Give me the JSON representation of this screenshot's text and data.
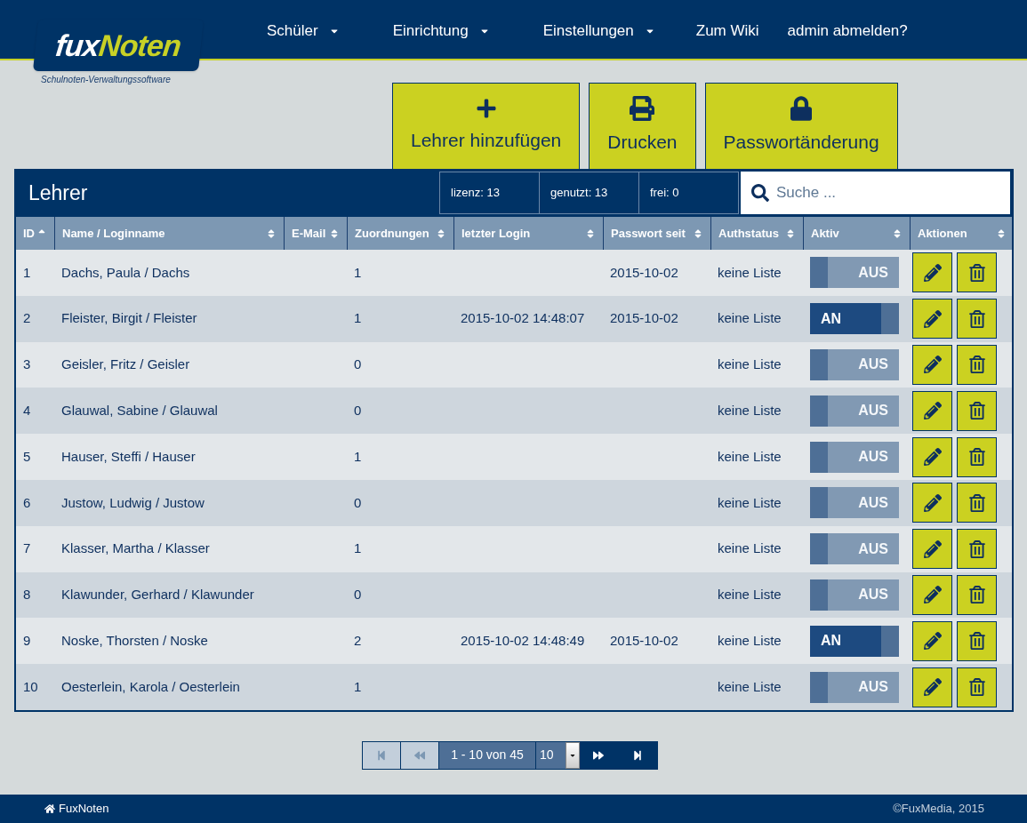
{
  "brand": {
    "name_part1": "fux",
    "name_part2": "Noten",
    "tagline": "Schulnoten-Verwaltungssoftware"
  },
  "nav": [
    {
      "label": "Schüler",
      "kind": "dropdown"
    },
    {
      "label": "Einrichtung",
      "kind": "dropdown"
    },
    {
      "label": "Einstellungen",
      "kind": "dropdown"
    },
    {
      "label": "Zum Wiki",
      "kind": "link"
    },
    {
      "label": "admin abmelden?",
      "kind": "link"
    }
  ],
  "actions": [
    {
      "label": "Lehrer hinzufügen",
      "kind": "add"
    },
    {
      "label": "Drucken",
      "kind": "print"
    },
    {
      "label": "Passwortänderung",
      "kind": "lock"
    }
  ],
  "panel": {
    "title": "Lehrer",
    "stats": [
      "lizenz: 13",
      "genutzt: 13",
      "frei: 0"
    ],
    "search": {
      "placeholder": "Suche ..."
    }
  },
  "table": {
    "columns": [
      {
        "label": "ID",
        "sorted": true
      },
      {
        "label": "Name / Loginname",
        "sorted": false
      },
      {
        "label": "E-Mail",
        "sorted": false
      },
      {
        "label": "Zuordnungen",
        "sorted": false
      },
      {
        "label": "letzter Login",
        "sorted": false
      },
      {
        "label": "Passwort seit",
        "sorted": false
      },
      {
        "label": "Authstatus",
        "sorted": false
      },
      {
        "label": "Aktiv",
        "sorted": false
      },
      {
        "label": "Aktionen",
        "sorted": false
      }
    ],
    "rows": [
      {
        "id": "1",
        "name": "Dachs, Paula / Dachs",
        "count": "1",
        "last_login": "",
        "password_since": "2015-10-02",
        "auth": "keine Liste",
        "active": false,
        "toggle_label": "AUS"
      },
      {
        "id": "2",
        "name": "Fleister, Birgit / Fleister",
        "count": "1",
        "last_login": "2015-10-02 14:48:07",
        "password_since": "2015-10-02",
        "auth": "keine Liste",
        "active": true,
        "toggle_label": "AN"
      },
      {
        "id": "3",
        "name": "Geisler, Fritz / Geisler",
        "count": "0",
        "last_login": "",
        "password_since": "",
        "auth": "keine Liste",
        "active": false,
        "toggle_label": "AUS"
      },
      {
        "id": "4",
        "name": "Glauwal, Sabine / Glauwal",
        "count": "0",
        "last_login": "",
        "password_since": "",
        "auth": "keine Liste",
        "active": false,
        "toggle_label": "AUS"
      },
      {
        "id": "5",
        "name": "Hauser, Steffi / Hauser",
        "count": "1",
        "last_login": "",
        "password_since": "",
        "auth": "keine Liste",
        "active": false,
        "toggle_label": "AUS"
      },
      {
        "id": "6",
        "name": "Justow, Ludwig / Justow",
        "count": "0",
        "last_login": "",
        "password_since": "",
        "auth": "keine Liste",
        "active": false,
        "toggle_label": "AUS"
      },
      {
        "id": "7",
        "name": "Klasser, Martha / Klasser",
        "count": "1",
        "last_login": "",
        "password_since": "",
        "auth": "keine Liste",
        "active": false,
        "toggle_label": "AUS"
      },
      {
        "id": "8",
        "name": "Klawunder, Gerhard / Klawunder",
        "count": "0",
        "last_login": "",
        "password_since": "",
        "auth": "keine Liste",
        "active": false,
        "toggle_label": "AUS"
      },
      {
        "id": "9",
        "name": "Noske, Thorsten / Noske",
        "count": "2",
        "last_login": "2015-10-02 14:48:49",
        "password_since": "2015-10-02",
        "auth": "keine Liste",
        "active": true,
        "toggle_label": "AN"
      },
      {
        "id": "10",
        "name": "Oesterlein, Karola / Oesterlein",
        "count": "1",
        "last_login": "",
        "password_since": "",
        "auth": "keine Liste",
        "active": false,
        "toggle_label": "AUS"
      }
    ]
  },
  "pagination": {
    "first_disabled": true,
    "prev_disabled": true,
    "range": "1 - 10 von 45",
    "page_size": "10",
    "next_disabled": false,
    "last_disabled": false
  },
  "footer": {
    "home": "FuxNoten",
    "copyright": "©FuxMedia, 2015"
  }
}
